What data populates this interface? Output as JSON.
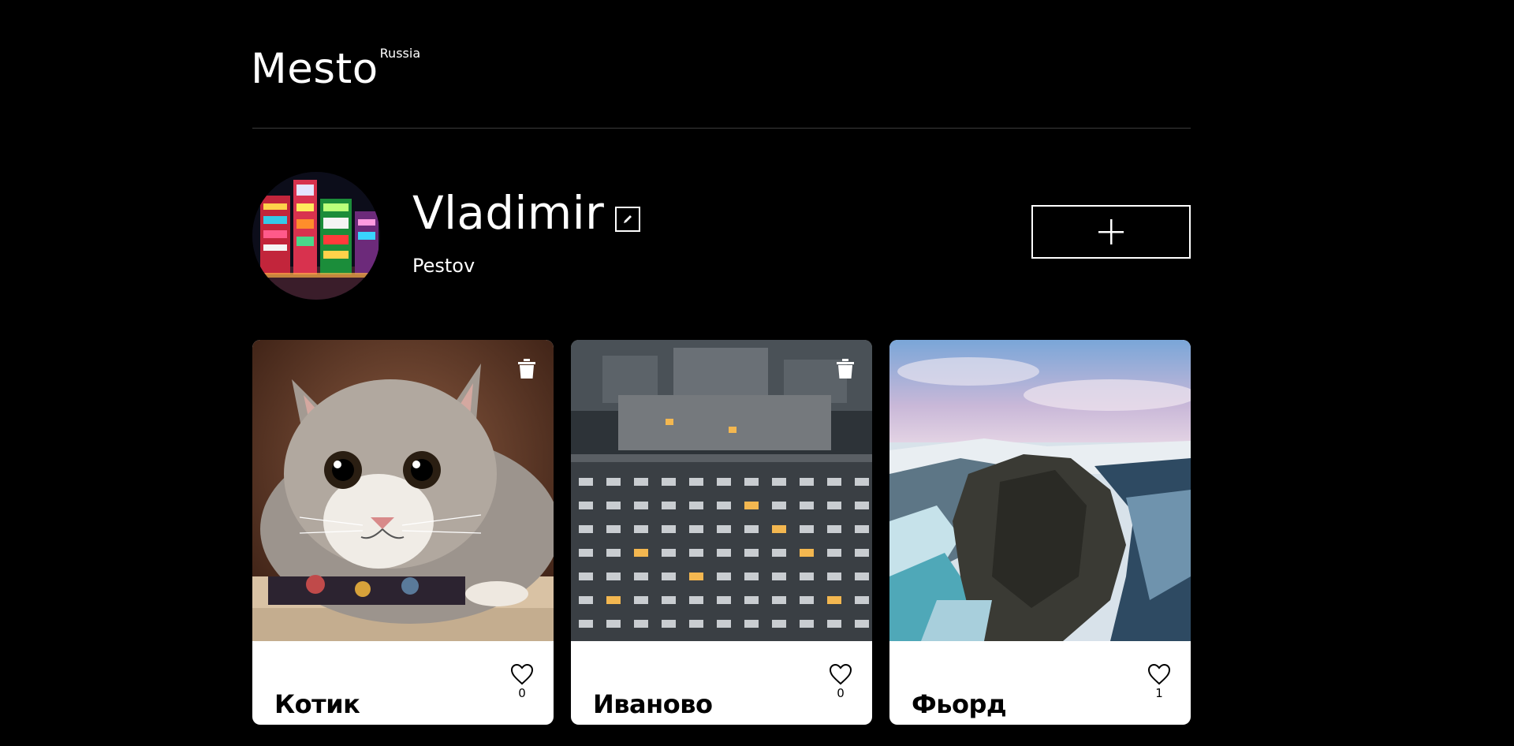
{
  "header": {
    "logo": "Mesto",
    "logo_suffix": "Russia"
  },
  "profile": {
    "name": "Vladimir",
    "about": "Pestov",
    "avatar_icon": "city-night-avatar",
    "edit_icon": "pencil-icon",
    "add_icon": "plus-icon"
  },
  "cards": [
    {
      "title": "Котик",
      "likes": "0",
      "image_icon": "cat-photo",
      "has_trash": true
    },
    {
      "title": "Иваново",
      "likes": "0",
      "image_icon": "apartment-building-photo",
      "has_trash": true
    },
    {
      "title": "Фьорд",
      "likes": "1",
      "image_icon": "fjord-photo",
      "has_trash": false
    }
  ],
  "colors": {
    "background": "#000000",
    "card": "#ffffff",
    "text_dark": "#000000",
    "text_light": "#ffffff"
  }
}
